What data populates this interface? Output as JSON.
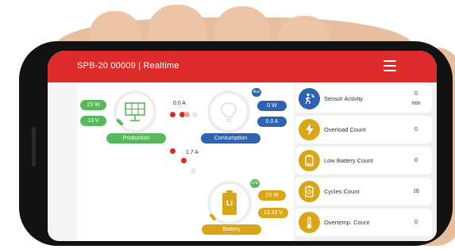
{
  "header": {
    "title": "SPB-20 00009 | Realtime"
  },
  "flow": {
    "production": {
      "label": "Production",
      "power": "23 W",
      "voltage": "13 V"
    },
    "consumption": {
      "label": "Consumption",
      "badge": "Aux",
      "power": "0 W",
      "current": "0.0 A"
    },
    "battery": {
      "label": "Battery",
      "badge": "LFE",
      "power": "23 W",
      "voltage": "13.33 V",
      "chemistry": "Li"
    },
    "current_top": "0.0 A",
    "current_mid": "1.7 A"
  },
  "stats": [
    {
      "label": "Sensor Activity",
      "value": "0",
      "unit": "min",
      "icon": "sensor-activity-icon",
      "icon_color": "#2f62b0"
    },
    {
      "label": "Overload Count",
      "value": "0",
      "unit": "",
      "icon": "lightning-icon",
      "icon_color": "#d8a51b"
    },
    {
      "label": "Low Battery Count",
      "value": "0",
      "unit": "",
      "icon": "low-battery-icon",
      "icon_color": "#d8a51b"
    },
    {
      "label": "Cycles Count",
      "value": "16",
      "unit": "",
      "icon": "battery-cycle-icon",
      "icon_color": "#d8a51b"
    },
    {
      "label": "Overtemp. Count",
      "value": "0",
      "unit": "",
      "icon": "thermometer-icon",
      "icon_color": "#d8a51b"
    }
  ],
  "colors": {
    "header": "#de2b2b",
    "production": "#58b85b",
    "consumption": "#2f62b0",
    "battery": "#d8a51b",
    "flow_dot": "#d72a2a"
  }
}
